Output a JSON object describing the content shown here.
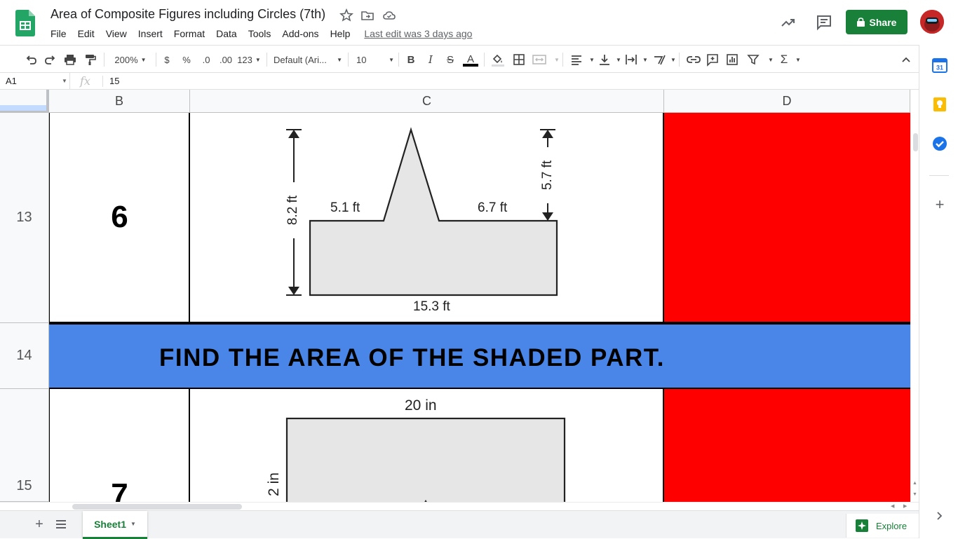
{
  "app": {
    "doc_title": "Area of Composite Figures including Circles (7th)",
    "last_edit": "Last edit was 3 days ago",
    "share_label": "Share"
  },
  "menu": [
    "File",
    "Edit",
    "View",
    "Insert",
    "Format",
    "Data",
    "Tools",
    "Add-ons",
    "Help"
  ],
  "toolbar": {
    "zoom": "200%",
    "currency": "$",
    "percent": "%",
    "decimal_decrease": ".0",
    "decimal_increase": ".00",
    "number_format": "123",
    "font": "Default (Ari...",
    "font_size": "10",
    "bold": "B",
    "italic": "I",
    "strike": "S",
    "text_color": "A",
    "sigma": "Σ"
  },
  "formula_bar": {
    "cell_ref": "A1",
    "fx": "fx",
    "value": "15"
  },
  "grid": {
    "columns": [
      "B",
      "C",
      "D"
    ],
    "rows": [
      "13",
      "14",
      "15"
    ],
    "row13_number": "6",
    "row15_number": "7",
    "banner": "FIND THE AREA OF THE SHADED PART."
  },
  "figure1": {
    "height_total": "8.2 ft",
    "triangle_height": "5.7 ft",
    "left_top": "5.1 ft",
    "right_top": "6.7 ft",
    "base": "15.3 ft"
  },
  "figure2": {
    "top": "20 in",
    "side": "2 in"
  },
  "bottom": {
    "sheet_name": "Sheet1",
    "explore": "Explore"
  },
  "colors": {
    "green": "#188038",
    "banner_blue": "#4a86e8",
    "red_fill": "#ff0000",
    "figure_fill": "#e6e6e6"
  }
}
